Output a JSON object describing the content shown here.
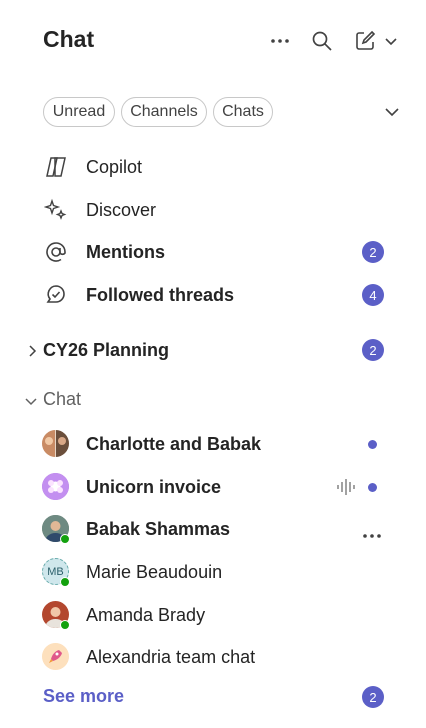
{
  "header": {
    "title": "Chat"
  },
  "filters": [
    "Unread",
    "Channels",
    "Chats"
  ],
  "nav": [
    {
      "label": "Copilot",
      "bold": false
    },
    {
      "label": "Discover",
      "bold": false
    },
    {
      "label": "Mentions",
      "bold": true,
      "badge": "2"
    },
    {
      "label": "Followed threads",
      "bold": true,
      "badge": "4"
    }
  ],
  "team": {
    "label": "CY26 Planning",
    "badge": "2"
  },
  "chat_section": {
    "label": "Chat"
  },
  "chats": [
    {
      "name": "Charlotte and Babak",
      "bold": true,
      "unread": true
    },
    {
      "name": "Unicorn invoice",
      "bold": true,
      "unread": true,
      "audio": true
    },
    {
      "name": "Babak Shammas",
      "bold": true,
      "more": true
    },
    {
      "name": "Marie Beaudouin",
      "bold": false,
      "initials": "MB"
    },
    {
      "name": "Amanda Brady",
      "bold": false
    },
    {
      "name": "Alexandria team chat",
      "bold": false
    }
  ],
  "see_more": {
    "label": "See more",
    "badge": "2"
  },
  "colors": {
    "accent": "#5b5fc7",
    "presence": "#13a10e"
  }
}
